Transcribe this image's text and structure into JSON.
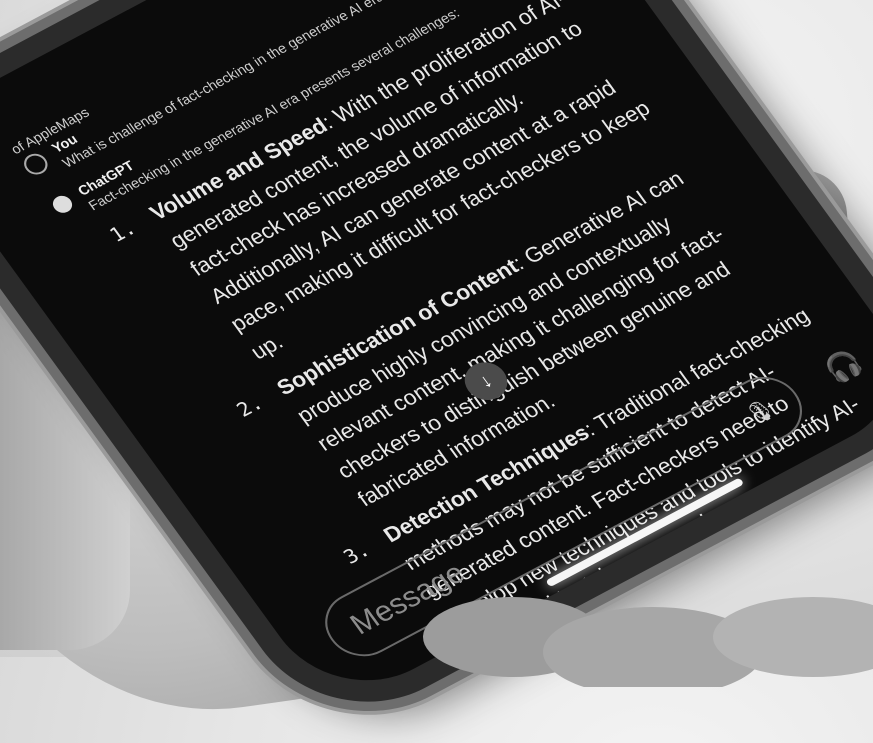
{
  "conversation": {
    "prev_snippet": "of AppleMaps",
    "user": {
      "role": "You",
      "text": "What is challenge of fact-checking in the generative AI era presently at era?"
    },
    "assistant": {
      "role": "ChatGPT",
      "intro": "Fact-checking in the generative AI era presents several challenges:",
      "points": [
        {
          "num": "1.",
          "title": "Volume and Speed",
          "text": ": With the proliferation of AI-generated content, the volume of information to fact-check has increased dramatically. Additionally, AI can generate content at a rapid pace, making it difficult for fact-checkers to keep up."
        },
        {
          "num": "2.",
          "title": "Sophistication of Content",
          "text": ": Generative AI can produce highly convincing and contextually relevant content, making it challenging for fact-checkers to distinguish between genuine and fabricated information."
        },
        {
          "num": "3.",
          "title": "Detection Techniques",
          "text": ": Traditional fact-checking methods may not be sufficient to detect AI-generated content. Fact-checkers need to develop new techniques and tools to identify AI-generated text, images, and"
        }
      ]
    }
  },
  "composer": {
    "placeholder": "Message"
  },
  "icons": {
    "mic": "microphone-icon",
    "headphones": "headphones-icon",
    "scroll": "arrow-down-icon"
  }
}
